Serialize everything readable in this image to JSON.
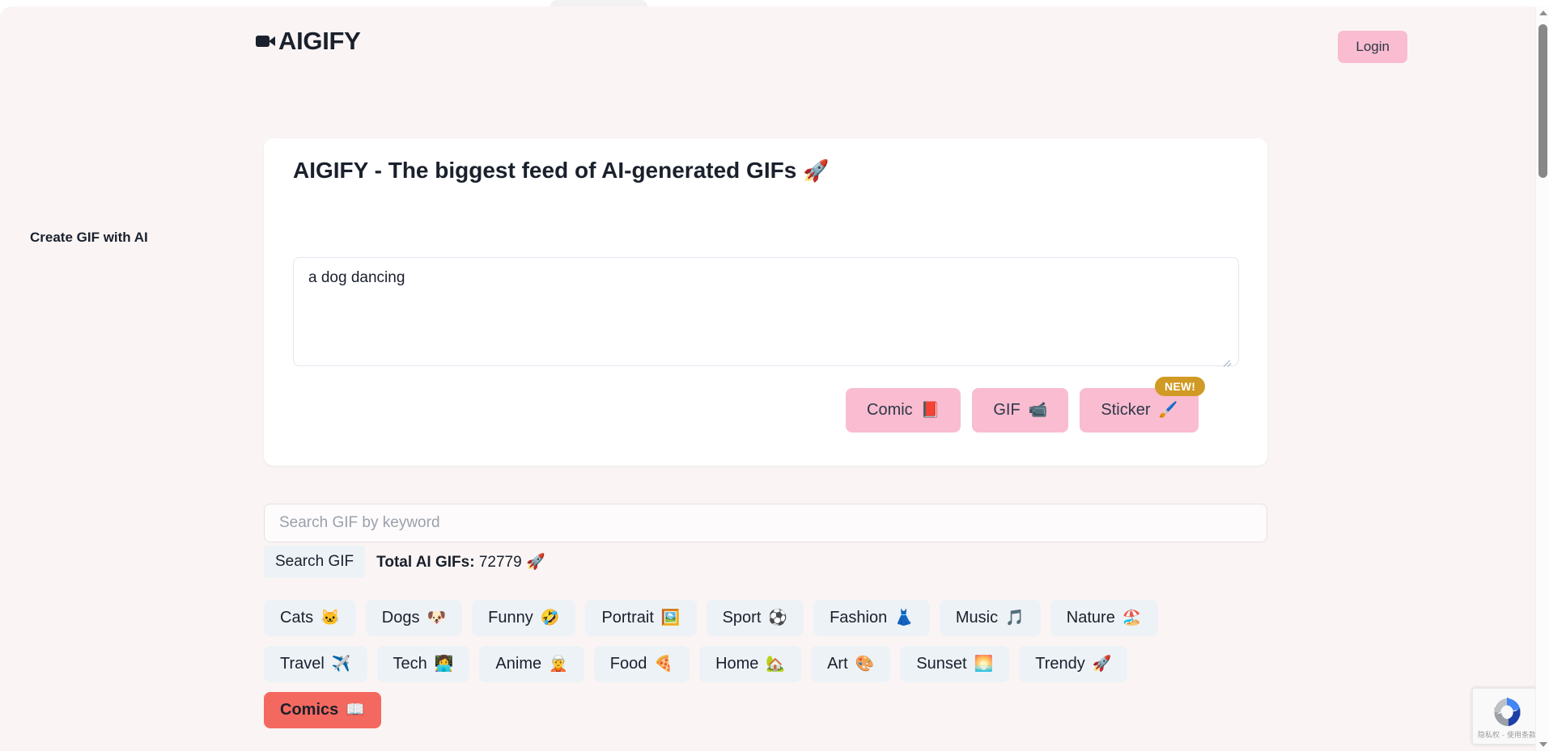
{
  "header": {
    "logo_icon": "video-camera-icon",
    "logo_text": "AIGIFY",
    "login_label": "Login"
  },
  "hero": {
    "title": "AIGIFY - The biggest feed of AI-generated GIFs",
    "title_emoji": "🚀",
    "field_label": "Create GIF with AI",
    "prompt_value": "a dog dancing",
    "prompt_placeholder": "",
    "actions": [
      {
        "label": "Comic",
        "emoji": "📕",
        "badge": ""
      },
      {
        "label": "GIF",
        "emoji": "📹",
        "badge": ""
      },
      {
        "label": "Sticker",
        "emoji": "🖌️",
        "badge": "NEW!"
      }
    ]
  },
  "search": {
    "placeholder": "Search GIF by keyword",
    "value": "",
    "button_label": "Search GIF",
    "total_label": "Total AI GIFs:",
    "total_count": "72779",
    "total_emoji": "🚀"
  },
  "tags": {
    "row1": [
      {
        "label": "Cats",
        "emoji": "🐱"
      },
      {
        "label": "Dogs",
        "emoji": "🐶"
      },
      {
        "label": "Funny",
        "emoji": "🤣"
      },
      {
        "label": "Portrait",
        "emoji": "🖼️"
      },
      {
        "label": "Sport",
        "emoji": "⚽"
      },
      {
        "label": "Fashion",
        "emoji": "👗"
      },
      {
        "label": "Music",
        "emoji": "🎵"
      },
      {
        "label": "Nature",
        "emoji": "🏖️"
      }
    ],
    "row2": [
      {
        "label": "Travel",
        "emoji": "✈️"
      },
      {
        "label": "Tech",
        "emoji": "👩‍💻"
      },
      {
        "label": "Anime",
        "emoji": "🧝"
      },
      {
        "label": "Food",
        "emoji": "🍕"
      },
      {
        "label": "Home",
        "emoji": "🏡"
      },
      {
        "label": "Art",
        "emoji": "🎨"
      },
      {
        "label": "Sunset",
        "emoji": "🌅"
      },
      {
        "label": "Trendy",
        "emoji": "🚀"
      }
    ],
    "row3": [
      {
        "label": "Comics",
        "emoji": "📖",
        "active": true
      }
    ]
  },
  "recaptcha": {
    "text": "隐私权 - 使用条款"
  },
  "colors": {
    "page_background": "#faf5f4",
    "accent_pink": "#f9bcd0",
    "active_tag": "#f4695f",
    "tag_background": "#edf2f7",
    "badge_gold": "#d19a24",
    "text_dark": "#1a202c"
  }
}
